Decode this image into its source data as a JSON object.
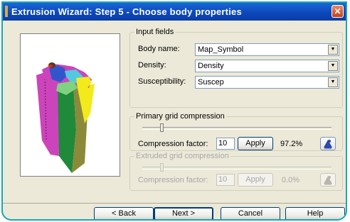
{
  "window": {
    "title": "Extrusion Wizard:  Step 5  -  Choose body properties",
    "close_glyph": "✕"
  },
  "input_fields": {
    "legend": "Input fields",
    "body_name": {
      "label": "Body name:",
      "value": "Map_Symbol"
    },
    "density": {
      "label": "Density:",
      "value": "Density"
    },
    "susceptibility": {
      "label": "Susceptibility:",
      "value": "Suscep"
    }
  },
  "primary": {
    "legend": "Primary grid compression",
    "factor_label": "Compression factor:",
    "factor_value": "10",
    "apply_label": "Apply",
    "percent": "97.2%",
    "slider_fraction": 0.1
  },
  "extruded": {
    "legend": "Extruded grid compression",
    "factor_label": "Compression factor:",
    "factor_value": "10",
    "apply_label": "Apply",
    "percent": "0.0%",
    "slider_fraction": 0.1
  },
  "buttons": {
    "back": "< Back",
    "next": "Next >",
    "cancel": "Cancel",
    "help": "Help"
  },
  "icons": {
    "dropdown": "chevron-down-icon",
    "info": "info-person-icon"
  },
  "colors": {
    "titlebar": "#0d46b8",
    "frame": "#16a7b5",
    "body_magenta": "#cc44bb",
    "body_green": "#1f8a3a",
    "body_yellow": "#f2ea1a",
    "body_olive": "#8a8a3a",
    "body_blue": "#3355cc",
    "body_cyan": "#55c8e0"
  }
}
